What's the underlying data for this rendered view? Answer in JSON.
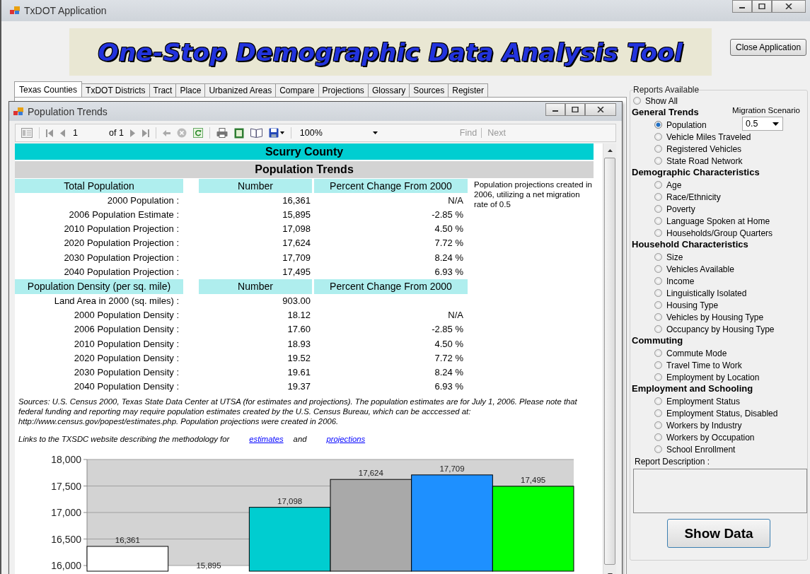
{
  "window": {
    "title": "TxDOT Application"
  },
  "banner": {
    "title": "One-Stop Demographic Data Analysis Tool"
  },
  "close_button": "Close Application",
  "tabs": [
    {
      "label": "Texas Counties",
      "selected": true
    },
    {
      "label": "TxDOT Districts",
      "selected": false
    },
    {
      "label": "Tract",
      "selected": false
    },
    {
      "label": "Place",
      "selected": false
    },
    {
      "label": "Urbanized Areas",
      "selected": false
    },
    {
      "label": "Compare",
      "selected": false
    },
    {
      "label": "Projections",
      "selected": false
    },
    {
      "label": "Glossary",
      "selected": false
    },
    {
      "label": "Sources",
      "selected": false
    },
    {
      "label": "Register",
      "selected": false
    }
  ],
  "report_window": {
    "title": "Population Trends",
    "toolbar": {
      "page": "1",
      "page_of": "of 1",
      "zoom": "100%",
      "find": "Find",
      "next": "Next"
    },
    "report": {
      "county": "Scurry County",
      "title": "Population Trends",
      "note": "Population projections created in 2006, utilizing a net migration rate of 0.5",
      "sections": [
        {
          "headers": [
            "Total Population",
            "Number",
            "Percent Change From 2000"
          ],
          "rows": [
            {
              "label": "2000 Population :",
              "number": "16,361",
              "change": "N/A"
            },
            {
              "label": "2006 Population Estimate :",
              "number": "15,895",
              "change": "-2.85 %"
            },
            {
              "label": "2010 Population Projection :",
              "number": "17,098",
              "change": "4.50 %"
            },
            {
              "label": "2020 Population Projection :",
              "number": "17,624",
              "change": "7.72 %"
            },
            {
              "label": "2030 Population Projection :",
              "number": "17,709",
              "change": "8.24 %"
            },
            {
              "label": "2040 Population Projection :",
              "number": "17,495",
              "change": "6.93 %"
            }
          ]
        },
        {
          "headers": [
            "Population Density (per sq. mile)",
            "Number",
            "Percent Change From 2000"
          ],
          "rows": [
            {
              "label": "Land Area in 2000 (sq. miles) :",
              "number": "903.00"
            },
            {
              "label": "2000 Population Density :",
              "number": "18.12",
              "change": "N/A"
            },
            {
              "label": "2006 Population Density :",
              "number": "17.60",
              "change": "-2.85 %"
            },
            {
              "label": "2010 Population Density :",
              "number": "18.93",
              "change": "4.50 %"
            },
            {
              "label": "2020 Population Density :",
              "number": "19.52",
              "change": "7.72 %"
            },
            {
              "label": "2030 Population Density :",
              "number": "19.61",
              "change": "8.24 %"
            },
            {
              "label": "2040 Population Density :",
              "number": "19.37",
              "change": "6.93 %"
            }
          ]
        }
      ],
      "sources": "Sources: U.S. Census 2000, Texas State Data Center at UTSA (for estimates and projections).  The population estimates are for July 1, 2006.  Please note that federal funding and reporting may require population estimates created by the U.S. Census Bureau, which can be acccessed at: http://www.census.gov/popest/estimates.php.  Population projections were created in 2006.",
      "links_text": "Links to the TXSDC website describing the methodology for",
      "link_1": "estimates",
      "links_and": "and",
      "link_2": "projections",
      "chart_data": {
        "type": "bar",
        "ylim": [
          16000,
          18000
        ],
        "yticks": [
          {
            "value": 16000,
            "label": "16,000"
          },
          {
            "value": 16500,
            "label": "16,500"
          },
          {
            "value": 17000,
            "label": "17,000"
          },
          {
            "value": 17500,
            "label": "17,500"
          },
          {
            "value": 18000,
            "label": "18,000"
          }
        ],
        "values": [
          16361,
          null,
          17098,
          17624,
          17709,
          17495
        ],
        "grid": true,
        "data_labels": true,
        "value_labels": [
          "16,361",
          "15,895",
          "17,098",
          "17,624",
          "17,709",
          "17,495"
        ]
      }
    }
  },
  "reports_panel": {
    "title": "Reports Available",
    "show_all": {
      "label": "Show All",
      "selected": false
    },
    "migration": {
      "label": "Migration Scenario",
      "value": "0.5"
    },
    "groups": [
      {
        "title": "General Trends",
        "items": [
          {
            "label": "Population",
            "selected": true
          },
          {
            "label": "Vehicle Miles Traveled",
            "selected": false
          },
          {
            "label": "Registered Vehicles",
            "selected": false
          },
          {
            "label": "State Road Network",
            "selected": false
          }
        ]
      },
      {
        "title": "Demographic Characteristics",
        "items": [
          {
            "label": "Age",
            "selected": false
          },
          {
            "label": "Race/Ethnicity",
            "selected": false
          },
          {
            "label": "Poverty",
            "selected": false
          },
          {
            "label": "Language Spoken at Home",
            "selected": false
          },
          {
            "label": "Households/Group Quarters",
            "selected": false
          }
        ]
      },
      {
        "title": "Household Characteristics",
        "items": [
          {
            "label": "Size",
            "selected": false
          },
          {
            "label": "Vehicles Available",
            "selected": false
          },
          {
            "label": "Income",
            "selected": false
          },
          {
            "label": "Linguistically Isolated",
            "selected": false
          },
          {
            "label": "Housing Type",
            "selected": false
          },
          {
            "label": "Vehicles by Housing Type",
            "selected": false
          },
          {
            "label": "Occupancy by Housing Type",
            "selected": false
          }
        ]
      },
      {
        "title": "Commuting",
        "items": [
          {
            "label": "Commute Mode",
            "selected": false
          },
          {
            "label": "Travel Time to Work",
            "selected": false
          },
          {
            "label": "Employment by Location",
            "selected": false
          }
        ]
      },
      {
        "title": "Employment and Schooling",
        "items": [
          {
            "label": "Employment Status",
            "selected": false
          },
          {
            "label": "Employment Status, Disabled",
            "selected": false
          },
          {
            "label": "Workers by Industry",
            "selected": false
          },
          {
            "label": "Workers by Occupation",
            "selected": false
          },
          {
            "label": "School Enrollment",
            "selected": false
          }
        ]
      }
    ],
    "description_label": "Report Description :",
    "show_button": "Show Data"
  }
}
